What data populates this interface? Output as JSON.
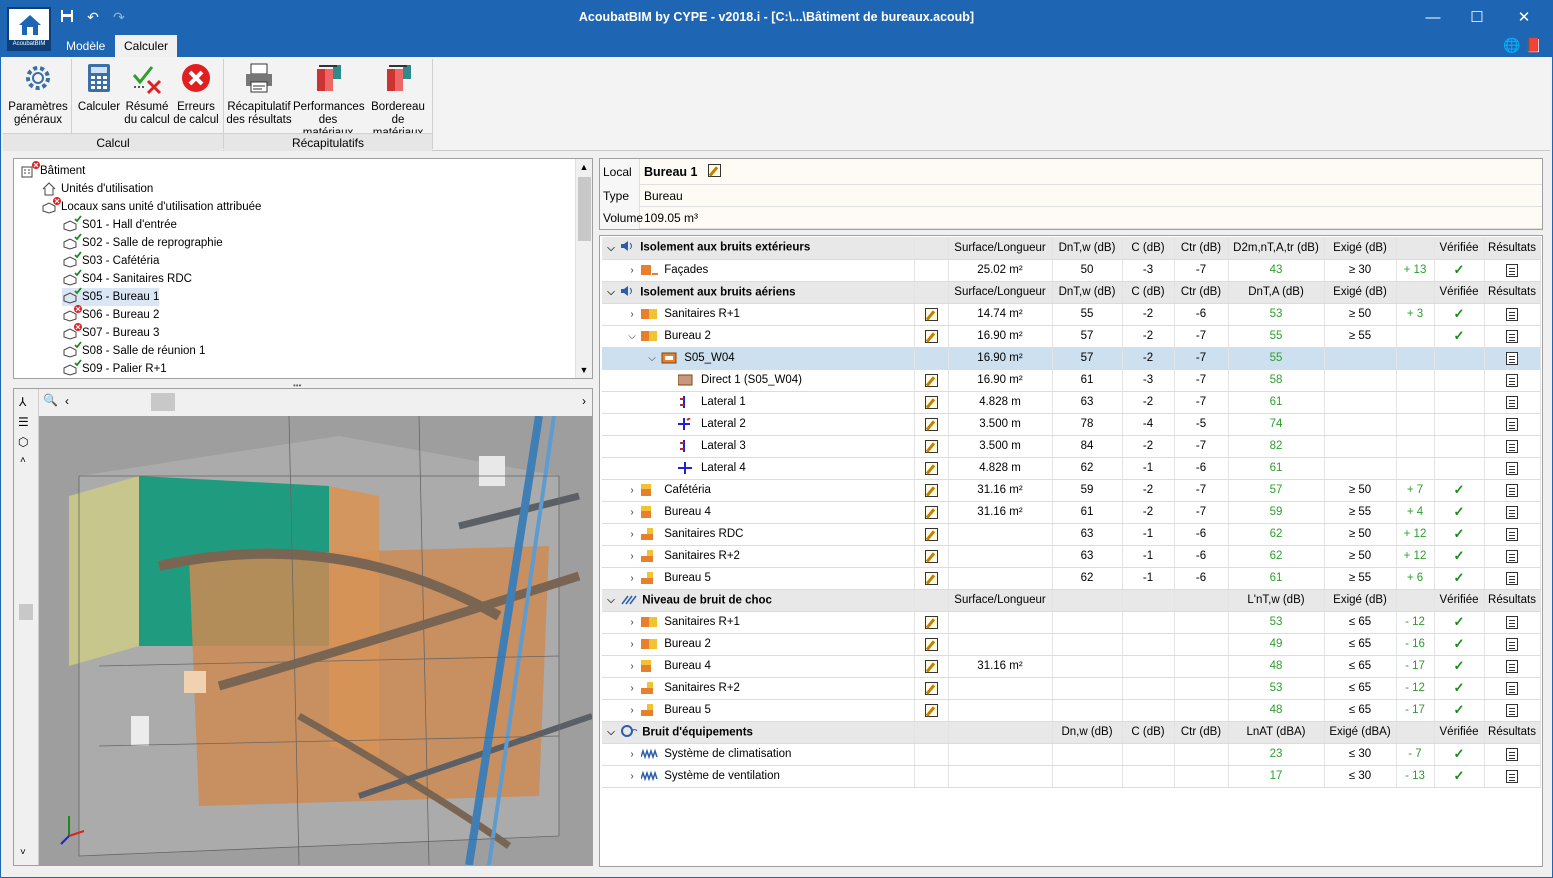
{
  "window": {
    "title": "AcoubatBIM by CYPE - v2018.i - [C:\\...\\Bâtiment de bureaux.acoub]",
    "app_logo_text": "AcoubatBIM",
    "tabs": [
      "Modèle",
      "Calculer"
    ],
    "active_tab": "Calculer"
  },
  "ribbon": {
    "buttons": [
      {
        "id": "params",
        "line1": "Paramètres",
        "line2": "généraux",
        "icon": "gear-icon"
      },
      {
        "id": "calc",
        "line1": "Calculer",
        "line2": "",
        "icon": "calculator-icon"
      },
      {
        "id": "summary",
        "line1": "Résumé",
        "line2": "du calcul",
        "icon": "check-cross-icon"
      },
      {
        "id": "errors",
        "line1": "Erreurs",
        "line2": "de calcul",
        "icon": "error-icon"
      },
      {
        "id": "recap",
        "line1": "Récapitulatif",
        "line2": "des résultats",
        "icon": "printer-icon"
      },
      {
        "id": "perf",
        "line1": "Performances",
        "line2": "des matériaux",
        "icon": "materials-icon"
      },
      {
        "id": "bord",
        "line1": "Bordereau",
        "line2": "de matériaux",
        "icon": "materials-icon"
      }
    ],
    "groups": [
      "Calcul",
      "Récapitulatifs"
    ]
  },
  "tree": {
    "items": [
      {
        "label": "Bâtiment",
        "level": 0,
        "status": "error"
      },
      {
        "label": "Unités d'utilisation",
        "level": 1,
        "status": "none"
      },
      {
        "label": "Locaux sans unité d'utilisation attribuée",
        "level": 1,
        "status": "error"
      },
      {
        "label": "S01 - Hall d'entrée",
        "level": 2,
        "status": "ok"
      },
      {
        "label": "S02 - Salle de reprographie",
        "level": 2,
        "status": "ok"
      },
      {
        "label": "S03 - Cafétéria",
        "level": 2,
        "status": "ok"
      },
      {
        "label": "S04 - Sanitaires RDC",
        "level": 2,
        "status": "ok"
      },
      {
        "label": "S05 - Bureau 1",
        "level": 2,
        "status": "ok",
        "selected": true
      },
      {
        "label": "S06 - Bureau 2",
        "level": 2,
        "status": "error"
      },
      {
        "label": "S07 - Bureau 3",
        "level": 2,
        "status": "error"
      },
      {
        "label": "S08 - Salle de réunion 1",
        "level": 2,
        "status": "ok"
      },
      {
        "label": "S09 - Palier R+1",
        "level": 2,
        "status": "ok"
      }
    ]
  },
  "local": {
    "local_label": "Local",
    "local_value": "Bureau 1",
    "type_label": "Type",
    "type_value": "Bureau",
    "volume_label": "Volume",
    "volume_value": "109.05 m³"
  },
  "sections": [
    {
      "title": "Isolement aux bruits extérieurs",
      "icon": "speaker-icon",
      "headers": [
        "Surface/Longueur",
        "DnT,w (dB)",
        "C (dB)",
        "Ctr (dB)",
        "D2m,nT,A,tr (dB)",
        "Exigé (dB)",
        "",
        "Vérifiée",
        "Résultats"
      ],
      "rows": [
        {
          "name": "Façades",
          "lvl": 1,
          "chev": ">",
          "sw": "orange-dash",
          "edit": false,
          "cells": [
            "25.02 m²",
            "50",
            "-3",
            "-7",
            "43",
            "≥ 30",
            "+ 13"
          ],
          "ok": true,
          "res": true
        }
      ]
    },
    {
      "title": "Isolement aux bruits aériens",
      "icon": "speaker-icon",
      "headers": [
        "Surface/Longueur",
        "DnT,w (dB)",
        "C (dB)",
        "Ctr (dB)",
        "DnT,A (dB)",
        "Exigé (dB)",
        "",
        "Vérifiée",
        "Résultats"
      ],
      "rows": [
        {
          "name": "Sanitaires R+1",
          "lvl": 1,
          "chev": ">",
          "sw": "orange-yellow",
          "edit": true,
          "cells": [
            "14.74 m²",
            "55",
            "-2",
            "-6",
            "53",
            "≥ 50",
            "+ 3"
          ],
          "ok": true,
          "res": true
        },
        {
          "name": "Bureau 2",
          "lvl": 1,
          "chev": "v",
          "sw": "orange-yellow",
          "edit": true,
          "cells": [
            "16.90 m²",
            "57",
            "-2",
            "-7",
            "55",
            "≥ 55",
            ""
          ],
          "ok": true,
          "res": true
        },
        {
          "name": "S05_W04",
          "lvl": 2,
          "chev": "v",
          "sw": "wall",
          "edit": false,
          "cells": [
            "16.90 m²",
            "57",
            "-2",
            "-7",
            "55",
            "",
            ""
          ],
          "ok": false,
          "res": true,
          "hl": true
        },
        {
          "name": "Direct 1 (S05_W04)",
          "lvl": 3,
          "chev": "",
          "sw": "brown",
          "edit": true,
          "cells": [
            "16.90 m²",
            "61",
            "-3",
            "-7",
            "58",
            "",
            ""
          ],
          "ok": false,
          "res": true
        },
        {
          "name": "Lateral 1",
          "lvl": 3,
          "chev": "",
          "sw": "lat-a",
          "edit": true,
          "cells": [
            "4.828 m",
            "63",
            "-2",
            "-7",
            "61",
            "",
            ""
          ],
          "ok": false,
          "res": true
        },
        {
          "name": "Lateral 2",
          "lvl": 3,
          "chev": "",
          "sw": "lat-b",
          "edit": true,
          "cells": [
            "3.500 m",
            "78",
            "-4",
            "-5",
            "74",
            "",
            ""
          ],
          "ok": false,
          "res": true
        },
        {
          "name": "Lateral 3",
          "lvl": 3,
          "chev": "",
          "sw": "lat-a",
          "edit": true,
          "cells": [
            "3.500 m",
            "84",
            "-2",
            "-7",
            "82",
            "",
            ""
          ],
          "ok": false,
          "res": true
        },
        {
          "name": "Lateral 4",
          "lvl": 3,
          "chev": "",
          "sw": "lat-c",
          "edit": true,
          "cells": [
            "4.828 m",
            "62",
            "-1",
            "-6",
            "61",
            "",
            ""
          ],
          "ok": false,
          "res": true
        },
        {
          "name": "Cafétéria",
          "lvl": 1,
          "chev": ">",
          "sw": "orange-top",
          "edit": true,
          "cells": [
            "31.16 m²",
            "59",
            "-2",
            "-7",
            "57",
            "≥ 50",
            "+ 7"
          ],
          "ok": true,
          "res": true
        },
        {
          "name": "Bureau 4",
          "lvl": 1,
          "chev": ">",
          "sw": "orange-top",
          "edit": true,
          "cells": [
            "31.16 m²",
            "61",
            "-2",
            "-7",
            "59",
            "≥ 55",
            "+ 4"
          ],
          "ok": true,
          "res": true
        },
        {
          "name": "Sanitaires RDC",
          "lvl": 1,
          "chev": ">",
          "sw": "orange-side",
          "edit": true,
          "cells": [
            "",
            "63",
            "-1",
            "-6",
            "62",
            "≥ 50",
            "+ 12"
          ],
          "ok": true,
          "res": true
        },
        {
          "name": "Sanitaires R+2",
          "lvl": 1,
          "chev": ">",
          "sw": "orange-side",
          "edit": true,
          "cells": [
            "",
            "63",
            "-1",
            "-6",
            "62",
            "≥ 50",
            "+ 12"
          ],
          "ok": true,
          "res": true
        },
        {
          "name": "Bureau 5",
          "lvl": 1,
          "chev": ">",
          "sw": "orange-side",
          "edit": true,
          "cells": [
            "",
            "62",
            "-1",
            "-6",
            "61",
            "≥ 55",
            "+ 6"
          ],
          "ok": true,
          "res": true
        }
      ]
    },
    {
      "title": "Niveau de bruit de choc",
      "icon": "impact-icon",
      "headers": [
        "Surface/Longueur",
        "",
        "",
        "",
        "L'nT,w (dB)",
        "Exigé (dB)",
        "",
        "Vérifiée",
        "Résultats"
      ],
      "rows": [
        {
          "name": "Sanitaires R+1",
          "lvl": 1,
          "chev": ">",
          "sw": "orange-yellow",
          "edit": true,
          "cells": [
            "",
            "",
            "",
            "",
            "53",
            "≤ 65",
            "- 12"
          ],
          "ok": true,
          "res": true
        },
        {
          "name": "Bureau 2",
          "lvl": 1,
          "chev": ">",
          "sw": "orange-yellow",
          "edit": true,
          "cells": [
            "",
            "",
            "",
            "",
            "49",
            "≤ 65",
            "- 16"
          ],
          "ok": true,
          "res": true
        },
        {
          "name": "Bureau 4",
          "lvl": 1,
          "chev": ">",
          "sw": "orange-top",
          "edit": true,
          "cells": [
            "31.16 m²",
            "",
            "",
            "",
            "48",
            "≤ 65",
            "- 17"
          ],
          "ok": true,
          "res": true
        },
        {
          "name": "Sanitaires R+2",
          "lvl": 1,
          "chev": ">",
          "sw": "orange-side",
          "edit": true,
          "cells": [
            "",
            "",
            "",
            "",
            "53",
            "≤ 65",
            "- 12"
          ],
          "ok": true,
          "res": true
        },
        {
          "name": "Bureau 5",
          "lvl": 1,
          "chev": ">",
          "sw": "orange-side",
          "edit": true,
          "cells": [
            "",
            "",
            "",
            "",
            "48",
            "≤ 65",
            "- 17"
          ],
          "ok": true,
          "res": true
        }
      ]
    },
    {
      "title": "Bruit d'équipements",
      "icon": "equipment-icon",
      "headers": [
        "",
        "Dn,w (dB)",
        "C (dB)",
        "Ctr (dB)",
        "LnAT (dBA)",
        "Exigé (dBA)",
        "",
        "Vérifiée",
        "Résultats"
      ],
      "rows": [
        {
          "name": "Système de climatisation",
          "lvl": 1,
          "chev": ">",
          "sw": "wave",
          "edit": false,
          "cells": [
            "",
            "",
            "",
            "",
            "23",
            "≤ 30",
            "- 7"
          ],
          "ok": true,
          "res": true
        },
        {
          "name": "Système de ventilation",
          "lvl": 1,
          "chev": ">",
          "sw": "wave",
          "edit": false,
          "cells": [
            "",
            "",
            "",
            "",
            "17",
            "≤ 30",
            "- 13"
          ],
          "ok": true,
          "res": true
        }
      ]
    }
  ],
  "colors": {
    "titlebar": "#1e66b4",
    "ok_green": "#2e9e2e",
    "highlight": "#cde0ef"
  },
  "glyphs": {
    "check": "✓",
    "chev_right": "❯",
    "chev_down": "⌄"
  }
}
